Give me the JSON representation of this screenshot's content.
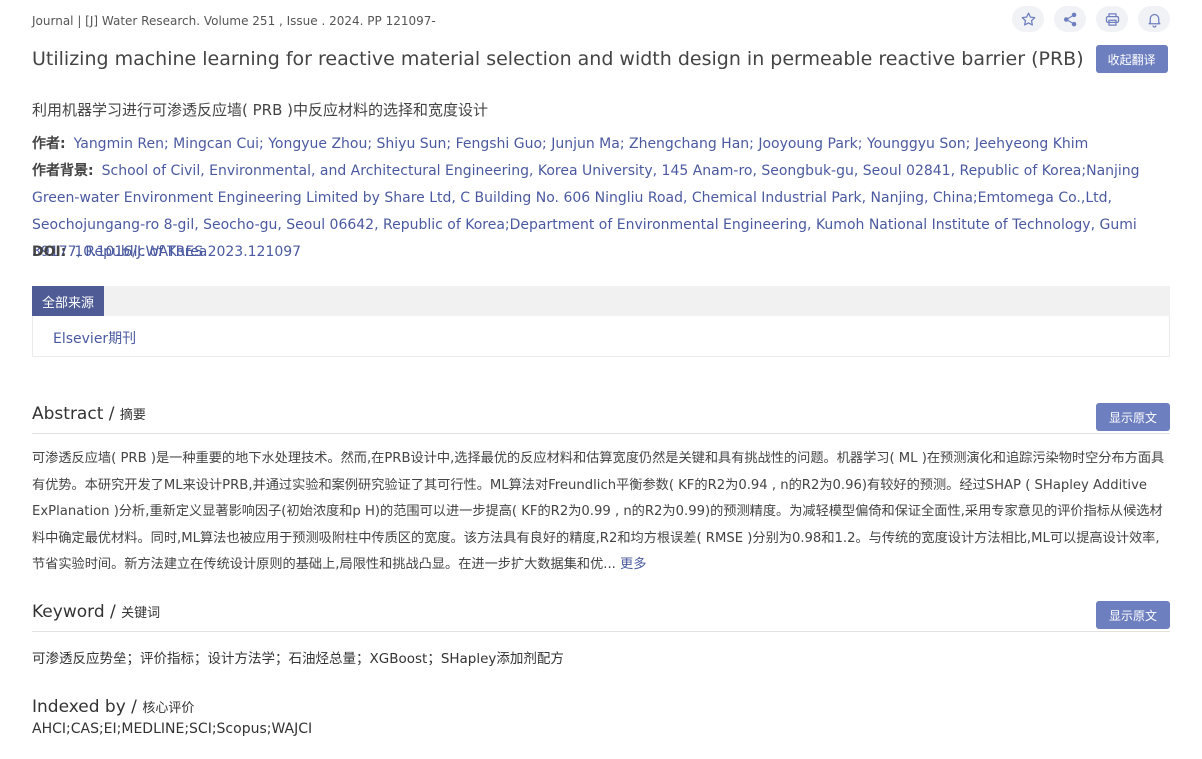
{
  "journal_line": "Journal | [J] Water Research. Volume 251 , Issue . 2024. PP 121097-",
  "toolbar": {
    "icons": [
      "star-icon",
      "share-icon",
      "print-icon",
      "bell-icon"
    ]
  },
  "title": "Utilizing machine learning for reactive material selection and width design in permeable reactive barrier (PRB)",
  "translate_button": "收起翻译",
  "subtitle": "利用机器学习进行可渗透反应墙( PRB )中反应材料的选择和宽度设计",
  "authors": {
    "label": "作者:",
    "value": "Yangmin Ren; Mingcan Cui; Yongyue Zhou; Shiyu Sun; Fengshi Guo; Junjun Ma; Zhengchang Han; Jooyoung Park; Younggyu Son; Jeehyeong Khim"
  },
  "affiliation": {
    "label": "作者背景:",
    "value": "School of Civil, Environmental, and Architectural Engineering, Korea University, 145 Anam-ro, Seongbuk-gu, Seoul 02841, Republic of Korea;Nanjing Green-water Environment Engineering Limited by Share Ltd, C Building No. 606 Ningliu Road, Chemical Industrial Park, Nanjing, China;Emtomega Co.,Ltd, Seochojungang-ro 8-gil, Seocho-gu, Seoul 06642, Republic of Korea;Department of Environmental Engineering, Kumoh National Institute of Technology, Gumi 39177, Republic of Korea"
  },
  "doi": {
    "label": "DOI:",
    "value": "10.1016/J.WATRES.2023.121097"
  },
  "sources": {
    "tab_label": "全部来源",
    "items": [
      "Elsevier期刊"
    ]
  },
  "abstract": {
    "title": "Abstract / ",
    "title_cn": "摘要",
    "show_original": "显示原文",
    "text": "可渗透反应墙( PRB )是一种重要的地下水处理技术。然而,在PRB设计中,选择最优的反应材料和估算宽度仍然是关键和具有挑战性的问题。机器学习( ML )在预测演化和追踪污染物时空分布方面具有优势。本研究开发了ML来设计PRB,并通过实验和案例研究验证了其可行性。ML算法对Freundlich平衡参数( KF的R2为0.94 , n的R2为0.96)有较好的预测。经过SHAP ( SHapley Additive ExPlanation )分析,重新定义显著影响因子(初始浓度和p H)的范围可以进一步提高( KF的R2为0.99 , n的R2为0.99)的预测精度。为减轻模型偏倚和保证全面性,采用专家意见的评价指标从候选材料中确定最优材料。同时,ML算法也被应用于预测吸附柱中传质区的宽度。该方法具有良好的精度,R2和均方根误差( RMSE )分别为0.98和1.2。与传统的宽度设计方法相比,ML可以提高设计效率,节省实验时间。新方法建立在传统设计原则的基础上,局限性和挑战凸显。在进一步扩大数据集和优...",
    "more": "更多"
  },
  "keyword": {
    "title": "Keyword / ",
    "title_cn": "关键词",
    "show_original": "显示原文",
    "text": "可渗透反应势垒；评价指标；设计方法学；石油烃总量；XGBoost；SHapley添加剂配方"
  },
  "indexed": {
    "title": "Indexed by / ",
    "title_cn": "核心评价",
    "text": "AHCI;CAS;EI;MEDLINE;SCI;Scopus;WAJCI"
  }
}
